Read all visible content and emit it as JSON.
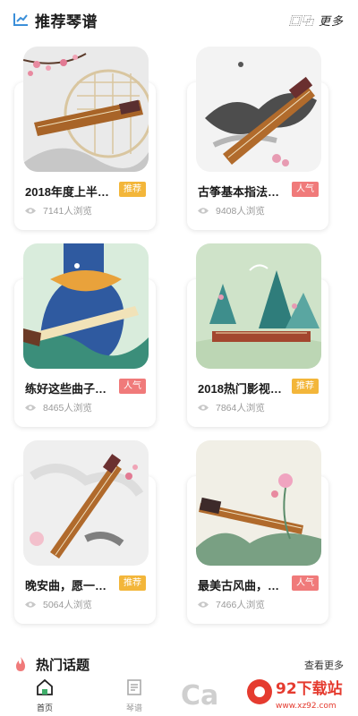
{
  "header": {
    "title": "推荐琴谱",
    "more_label": "更多",
    "more_icon": "grid-icon",
    "title_icon": "chart-icon",
    "accent": "#3b8fd9"
  },
  "cards": [
    {
      "title": "2018年度上半…",
      "tag": "推荐",
      "tag_type": "recommend",
      "views": "7141人浏览"
    },
    {
      "title": "古筝基本指法…",
      "tag": "人气",
      "tag_type": "hot",
      "views": "9408人浏览"
    },
    {
      "title": "练好这些曲子…",
      "tag": "人气",
      "tag_type": "hot",
      "views": "8465人浏览"
    },
    {
      "title": "2018热门影视…",
      "tag": "推荐",
      "tag_type": "recommend",
      "views": "7864人浏览"
    },
    {
      "title": "晚安曲，愿一…",
      "tag": "推荐",
      "tag_type": "recommend",
      "views": "5064人浏览"
    },
    {
      "title": "最美古风曲，…",
      "tag": "人气",
      "tag_type": "hot",
      "views": "7466人浏览"
    }
  ],
  "hot_topics": {
    "title": "热门话题",
    "more_label": "查看更多"
  },
  "nav": {
    "items": [
      {
        "label": "首页",
        "icon": "home-icon",
        "active": true
      },
      {
        "label": "琴谱",
        "icon": "score-icon",
        "active": false
      }
    ]
  },
  "watermark": {
    "text": "92下载站",
    "url": "www.xz92.com"
  },
  "colors": {
    "recommend": "#f3b63a",
    "hot": "#f07a7a"
  }
}
